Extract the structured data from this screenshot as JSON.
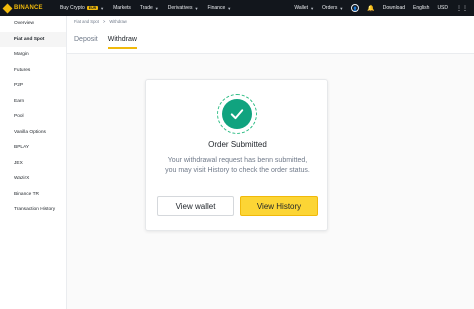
{
  "topnav": {
    "logo": "BINANCE",
    "items": [
      {
        "label": "Buy Crypto",
        "badge": "EUR",
        "caret": true
      },
      {
        "label": "Markets",
        "caret": false
      },
      {
        "label": "Trade",
        "caret": true
      },
      {
        "label": "Derivatives",
        "caret": true
      },
      {
        "label": "Finance",
        "caret": true
      }
    ],
    "right": {
      "wallet": "Wallet",
      "orders": "Orders",
      "download": "Download",
      "language": "English",
      "currency": "USD"
    }
  },
  "sidebar": {
    "items": [
      {
        "label": "Overview"
      },
      {
        "label": "Fiat and Spot"
      },
      {
        "label": "Margin"
      },
      {
        "label": "Futures"
      },
      {
        "label": "P2P"
      },
      {
        "label": "Earn"
      },
      {
        "label": "Pool"
      },
      {
        "label": "Vanilla Options"
      },
      {
        "label": "BPLAY"
      },
      {
        "label": "JEX"
      },
      {
        "label": "WazirX"
      },
      {
        "label": "Binance TR"
      },
      {
        "label": "Transaction History"
      }
    ],
    "active_index": 1
  },
  "breadcrumb": {
    "parent": "Fiat and Spot",
    "separator": ">",
    "current": "Withdraw"
  },
  "tabs": [
    {
      "label": "Deposit"
    },
    {
      "label": "Withdraw"
    }
  ],
  "dialog": {
    "title": "Order Submitted",
    "message": "Your withdrawal request has benn submitted, you may visit History to check the order status.",
    "secondary_button": "View wallet",
    "primary_button": "View History"
  },
  "colors": {
    "brand": "#f0b90b",
    "primary_button": "#fcd535",
    "success": "#10a37f",
    "topbar": "#12161c"
  }
}
